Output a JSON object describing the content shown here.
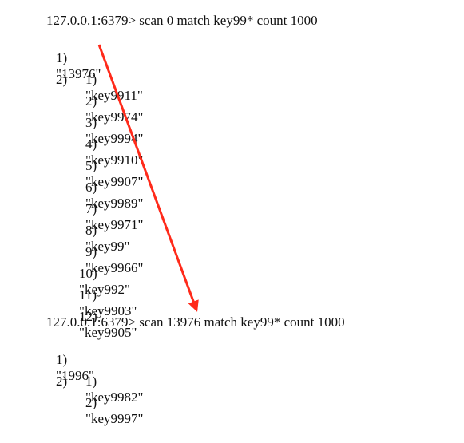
{
  "session": {
    "prompt1": "127.0.0.1:6379> scan 0 match key99* count 1000",
    "result1": {
      "cursor_index": "1)",
      "cursor": "\"13976\"",
      "keys_index": "2)",
      "keys": [
        {
          "index": "1)",
          "value": "\"key9911\""
        },
        {
          "index": "2)",
          "value": "\"key9974\""
        },
        {
          "index": "3)",
          "value": "\"key9994\""
        },
        {
          "index": "4)",
          "value": "\"key9910\""
        },
        {
          "index": "5)",
          "value": "\"key9907\""
        },
        {
          "index": "6)",
          "value": "\"key9989\""
        },
        {
          "index": "7)",
          "value": "\"key9971\""
        },
        {
          "index": "8)",
          "value": "\"key99\""
        },
        {
          "index": "9)",
          "value": "\"key9966\""
        },
        {
          "index": "10)",
          "value": "\"key992\""
        },
        {
          "index": "11)",
          "value": "\"key9903\""
        },
        {
          "index": "12)",
          "value": "\"key9905\""
        }
      ]
    },
    "prompt2": "127.0.0.1:6379> scan 13976 match key99* count 1000",
    "result2": {
      "cursor_index": "1)",
      "cursor": "\"1996\"",
      "keys_index": "2)",
      "keys": [
        {
          "index": "1)",
          "value": "\"key9982\""
        },
        {
          "index": "2)",
          "value": "\"key9997\""
        }
      ]
    }
  },
  "annotation": {
    "color": "#ff2a1a",
    "icon": "arrow-annotation-icon"
  }
}
